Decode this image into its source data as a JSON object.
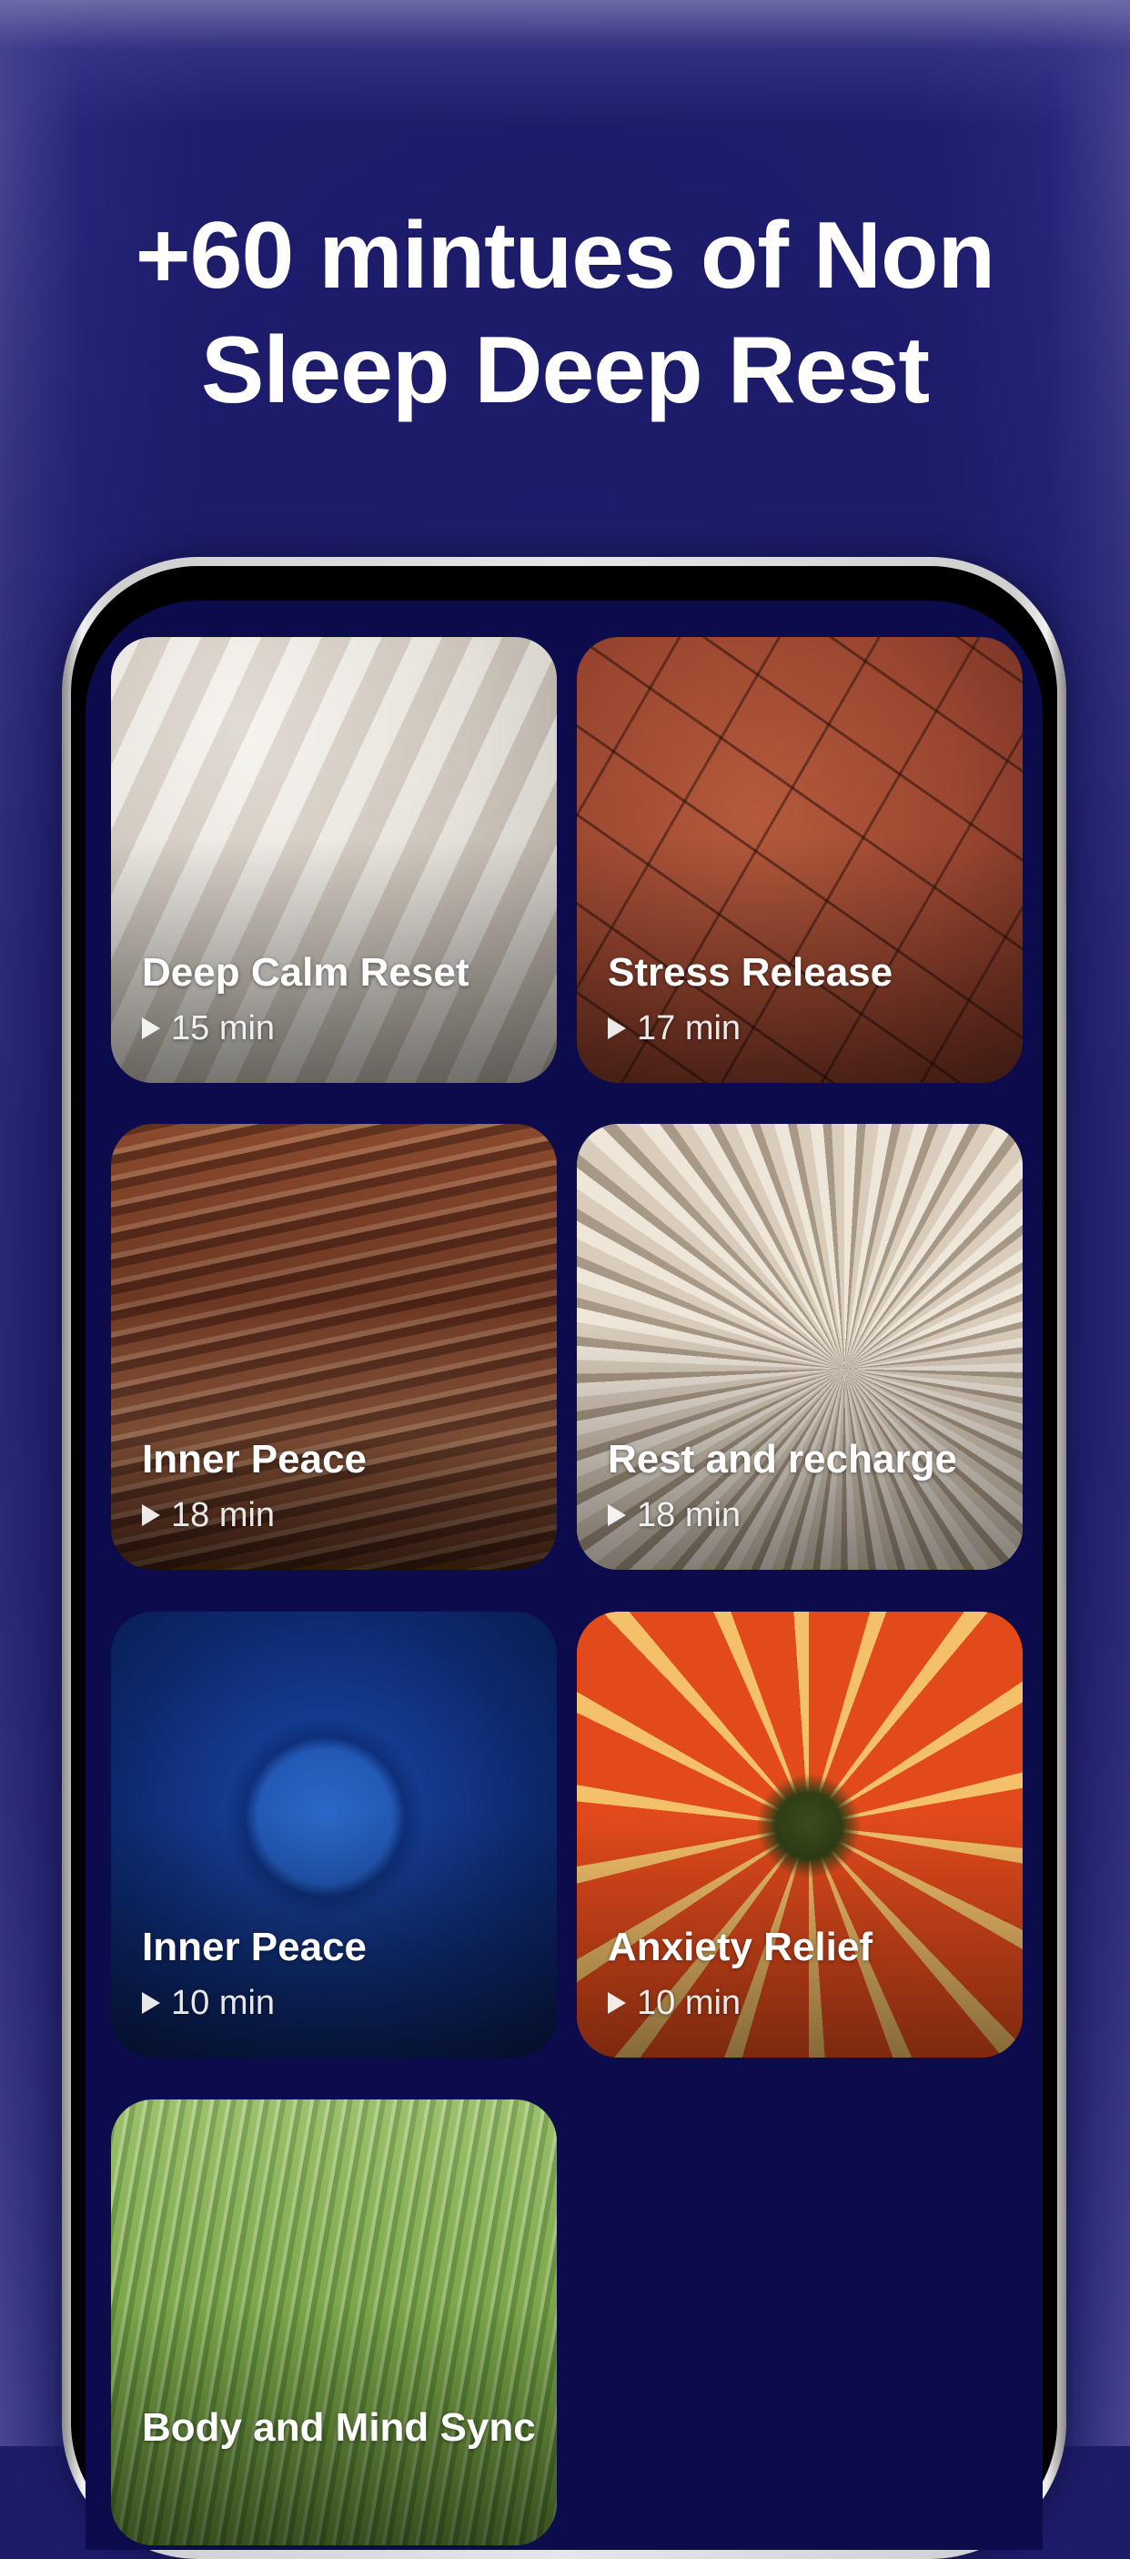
{
  "headline": {
    "line1": "+60 mintues of Non",
    "line2": "Sleep Deep Rest"
  },
  "sessions": [
    {
      "title": "Deep Calm Reset",
      "duration": "15 min",
      "icon": "play-icon"
    },
    {
      "title": "Stress Release",
      "duration": "17 min",
      "icon": "play-icon"
    },
    {
      "title": "Inner Peace",
      "duration": "18 min",
      "icon": "play-icon"
    },
    {
      "title": "Rest and recharge",
      "duration": "18 min",
      "icon": "play-icon"
    },
    {
      "title": "Inner Peace",
      "duration": "10 min",
      "icon": "play-icon"
    },
    {
      "title": "Anxiety Relief",
      "duration": "10 min",
      "icon": "play-icon"
    },
    {
      "title": "Body and Mind Sync"
    }
  ],
  "colors": {
    "background": "#1d1c6b",
    "screen": "#0c0b4c",
    "text": "#ffffff"
  }
}
